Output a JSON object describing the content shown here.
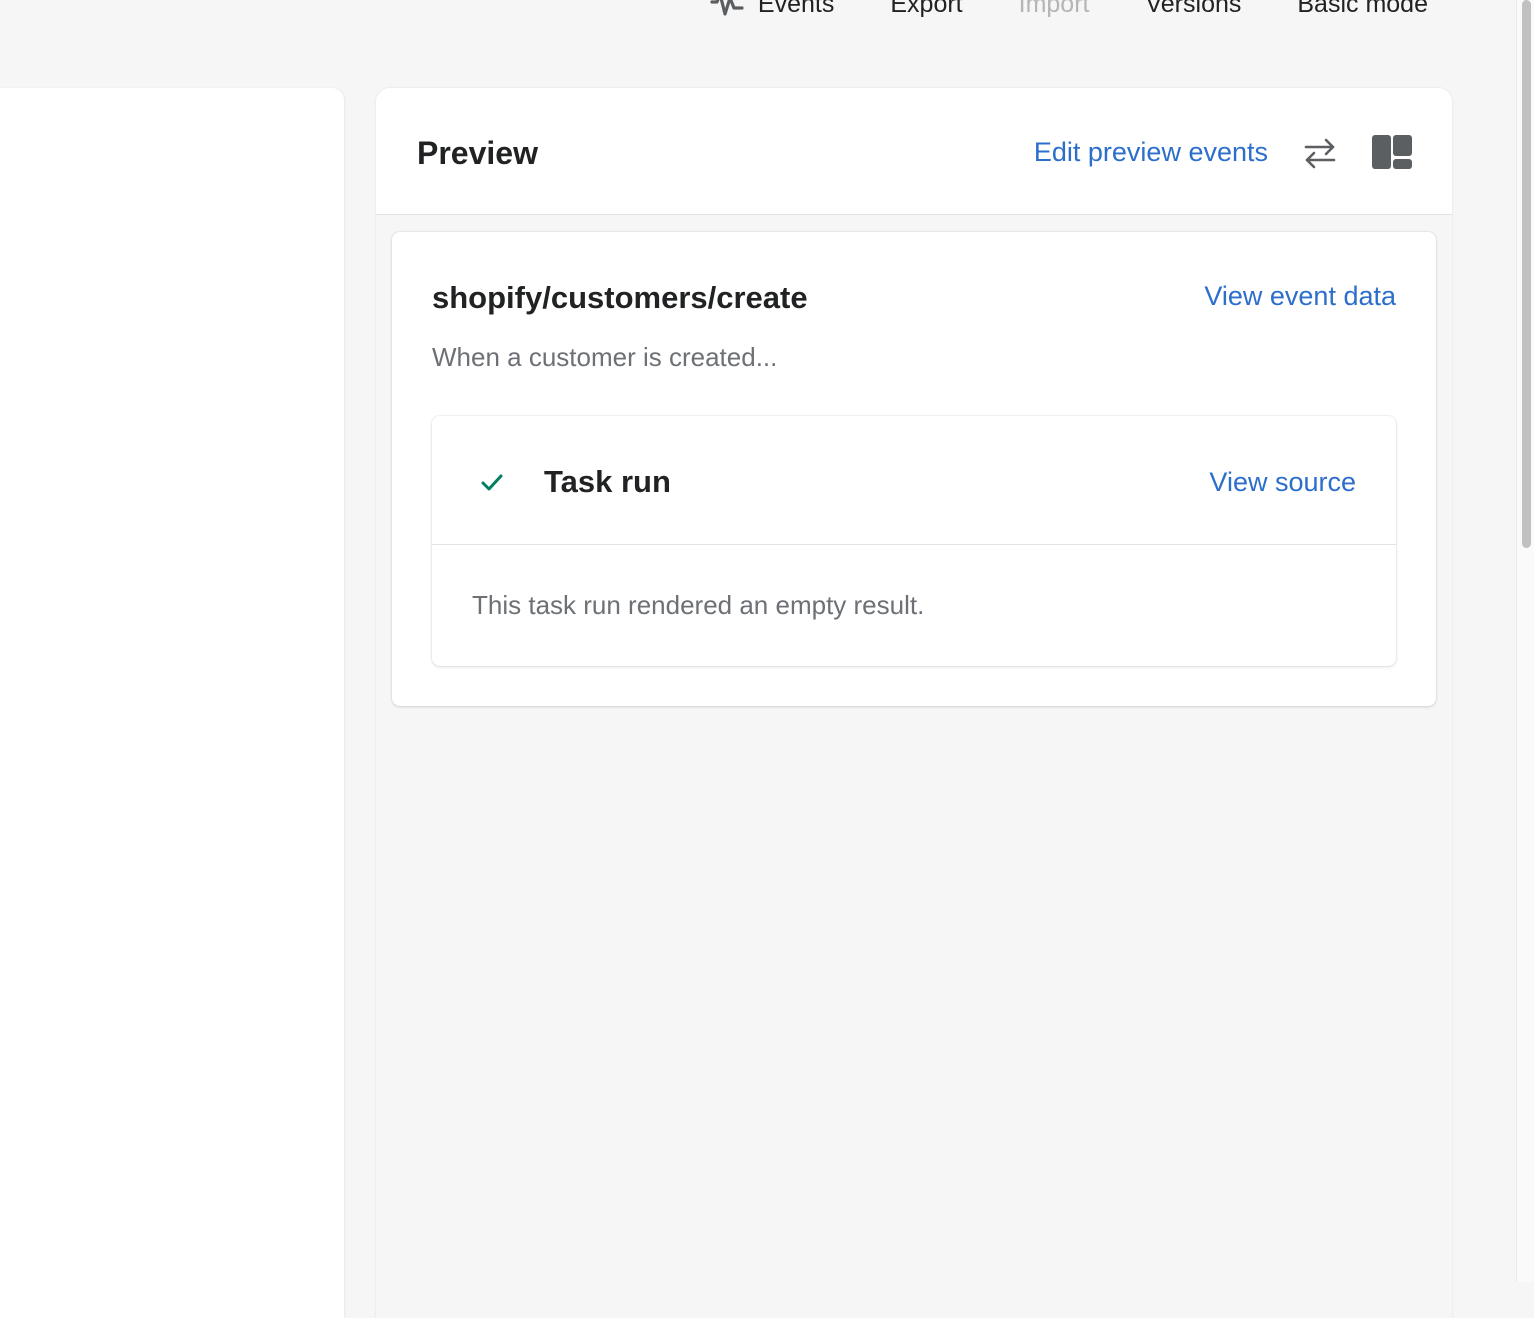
{
  "topnav": {
    "events_label": "Events",
    "export_label": "Export",
    "import_label": "Import",
    "versions_label": "Versions",
    "basic_mode_label": "Basic mode"
  },
  "preview": {
    "title": "Preview",
    "edit_events_label": "Edit preview events"
  },
  "event": {
    "title": "shopify/customers/create",
    "view_data_label": "View event data",
    "subtitle": "When a customer is created..."
  },
  "task": {
    "title": "Task run",
    "view_source_label": "View source",
    "result_text": "This task run rendered an empty result."
  },
  "colors": {
    "link": "#2c6ecb",
    "success": "#008060",
    "icon": "#5c5f62"
  }
}
